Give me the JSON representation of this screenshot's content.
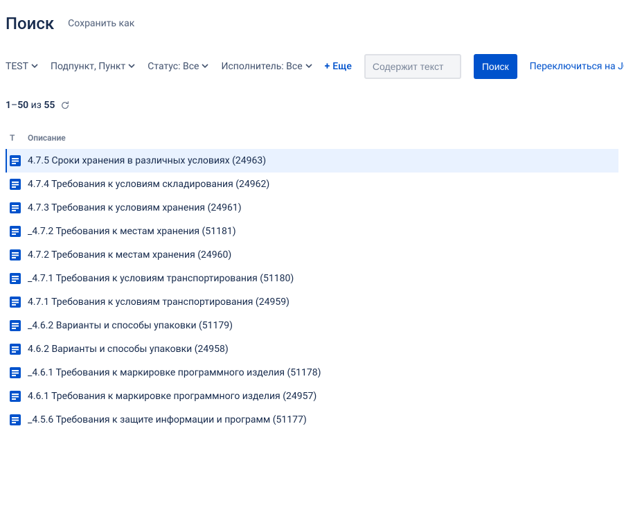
{
  "header": {
    "title": "Поиск",
    "save_as": "Сохранить как"
  },
  "filters": {
    "project": "TEST",
    "type": "Подпункт, Пункт",
    "status": "Статус: Все",
    "assignee": "Исполнитель: Все",
    "more": "Еще",
    "search_placeholder": "Содержит текст",
    "search_btn": "Поиск",
    "jql_switch": "Переключиться на JQL"
  },
  "count": {
    "from": "1",
    "to": "50",
    "of_word": "из",
    "total": "55"
  },
  "columns": {
    "t": "Т",
    "desc": "Описание"
  },
  "rows": [
    {
      "text": "4.7.5 Сроки хранения в различных условиях (24963)",
      "selected": true
    },
    {
      "text": "4.7.4 Требования к условиям складирования (24962)",
      "selected": false
    },
    {
      "text": "4.7.3 Требования к условиям хранения (24961)",
      "selected": false
    },
    {
      "text": "_4.7.2 Требования к местам хранения (51181)",
      "selected": false
    },
    {
      "text": "4.7.2 Требования к местам хранения (24960)",
      "selected": false
    },
    {
      "text": "_4.7.1 Требования к условиям транспортирования (51180)",
      "selected": false
    },
    {
      "text": "4.7.1 Требования к условиям транспортирования (24959)",
      "selected": false
    },
    {
      "text": "_4.6.2 Варианты и способы упаковки (51179)",
      "selected": false
    },
    {
      "text": "4.6.2 Варианты и способы упаковки (24958)",
      "selected": false
    },
    {
      "text": "_4.6.1 Требования к маркировке программного изделия (51178)",
      "selected": false
    },
    {
      "text": "4.6.1 Требования к маркировке программного изделия (24957)",
      "selected": false
    },
    {
      "text": "_4.5.6 Требования к защите информации и программ (51177)",
      "selected": false
    }
  ]
}
